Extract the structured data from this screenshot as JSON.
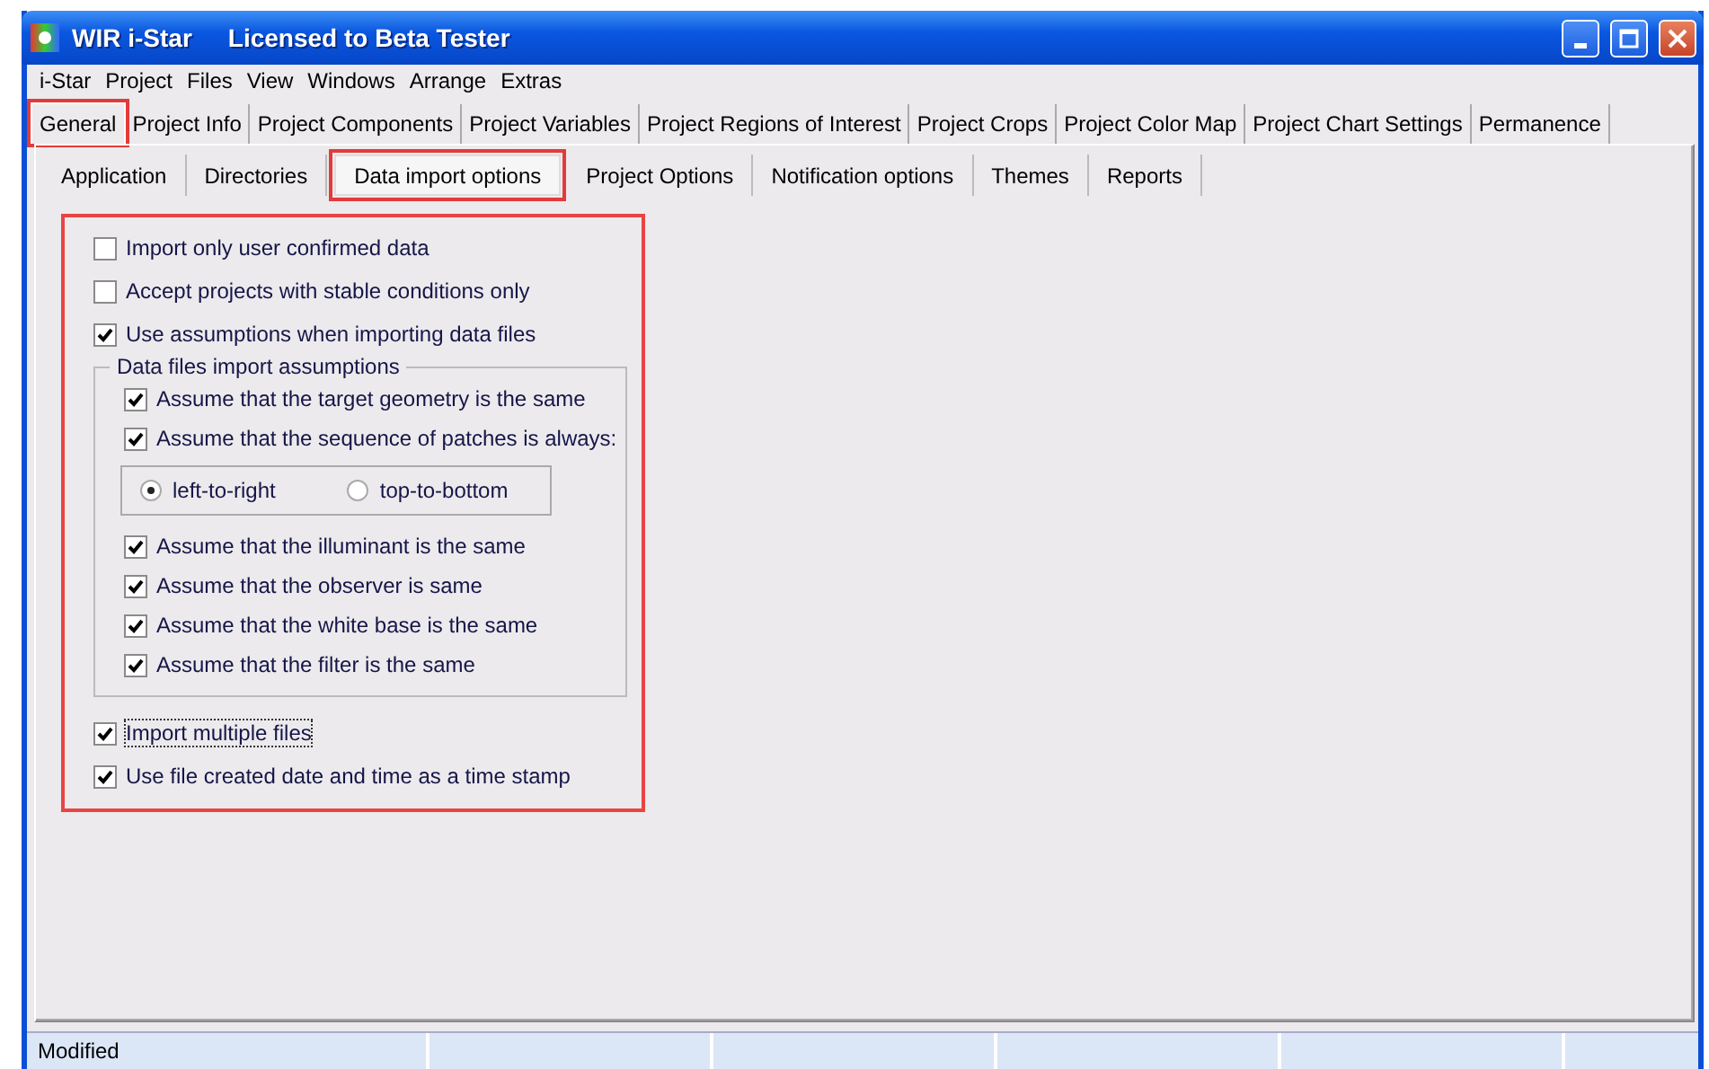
{
  "window": {
    "title": "WIR i-Star",
    "subtitle": "Licensed to Beta Tester"
  },
  "menu": [
    {
      "label": "i-Star"
    },
    {
      "label": "Project"
    },
    {
      "label": "Files"
    },
    {
      "label": "View"
    },
    {
      "label": "Windows"
    },
    {
      "label": "Arrange"
    },
    {
      "label": "Extras"
    }
  ],
  "tabs": [
    {
      "label": "General",
      "selected": true,
      "highlighted": true
    },
    {
      "label": "Project Info",
      "selected": false,
      "highlighted": false
    },
    {
      "label": "Project Components",
      "selected": false,
      "highlighted": false
    },
    {
      "label": "Project Variables",
      "selected": false,
      "highlighted": false
    },
    {
      "label": "Project Regions of Interest",
      "selected": false,
      "highlighted": false
    },
    {
      "label": "Project Crops",
      "selected": false,
      "highlighted": false
    },
    {
      "label": "Project Color Map",
      "selected": false,
      "highlighted": false
    },
    {
      "label": "Project Chart Settings",
      "selected": false,
      "highlighted": false
    },
    {
      "label": "Permanence",
      "selected": false,
      "highlighted": false
    }
  ],
  "subtabs": [
    {
      "label": "Application",
      "selected": false,
      "highlighted": false
    },
    {
      "label": "Directories",
      "selected": false,
      "highlighted": false
    },
    {
      "label": "Data import options",
      "selected": true,
      "highlighted": true
    },
    {
      "label": "Project Options",
      "selected": false,
      "highlighted": false
    },
    {
      "label": "Notification options",
      "selected": false,
      "highlighted": false
    },
    {
      "label": "Themes",
      "selected": false,
      "highlighted": false
    },
    {
      "label": "Reports",
      "selected": false,
      "highlighted": false
    }
  ],
  "options": {
    "highlighted": true,
    "items_before": [
      {
        "label": "Import only user confirmed data",
        "checked": false,
        "focused": false
      },
      {
        "label": "Accept projects with stable conditions only",
        "checked": false,
        "focused": false
      },
      {
        "label": "Use assumptions when importing data files",
        "checked": true,
        "focused": false
      }
    ],
    "group": {
      "title": "Data files import assumptions",
      "items": [
        {
          "kind": "checkbox",
          "label": "Assume that the target geometry is the same",
          "checked": true
        },
        {
          "kind": "checkbox",
          "label": "Assume that the sequence of patches is always:",
          "checked": true
        },
        {
          "kind": "radio_group",
          "options": [
            {
              "label": "left-to-right",
              "selected": true
            },
            {
              "label": "top-to-bottom",
              "selected": false
            }
          ]
        },
        {
          "kind": "checkbox",
          "label": "Assume that the illuminant is the same",
          "checked": true
        },
        {
          "kind": "checkbox",
          "label": "Assume that the observer is same",
          "checked": true
        },
        {
          "kind": "checkbox",
          "label": "Assume that the white base is the same",
          "checked": true
        },
        {
          "kind": "checkbox",
          "label": "Assume that the filter is the same",
          "checked": true
        }
      ]
    },
    "items_after": [
      {
        "label": "Import multiple files",
        "checked": true,
        "focused": true
      },
      {
        "label": "Use file created date and time as a time stamp",
        "checked": true,
        "focused": false
      }
    ]
  },
  "status_bar": {
    "text": "Modified"
  }
}
